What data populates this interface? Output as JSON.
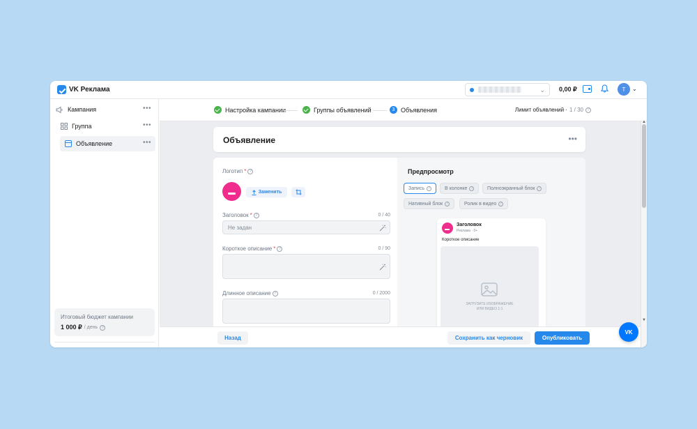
{
  "app": {
    "title": "VK Реклама"
  },
  "topbar": {
    "balance": "0,00 ₽",
    "avatar_initial": "Т",
    "account_chevron": "⌄",
    "avatar_chevron": "⌄"
  },
  "sidebar": {
    "items": [
      {
        "label": "Кампания",
        "icon": "megaphone-icon"
      },
      {
        "label": "Группа",
        "icon": "grid-icon"
      },
      {
        "label": "Объявление",
        "icon": "ad-card-icon"
      }
    ],
    "dots": "•••",
    "budget": {
      "label": "Итоговый бюджет кампании",
      "value": "1 000 ₽",
      "unit": "/ день"
    }
  },
  "stepper": {
    "steps": [
      {
        "label": "Настройка кампании",
        "state": "done"
      },
      {
        "label": "Группы объявлений",
        "state": "done"
      },
      {
        "label": "Объявления",
        "state": "current",
        "number": "3"
      }
    ],
    "limit_label": "Лимит объявлений ·",
    "limit_count": "1 / 30"
  },
  "header": {
    "title": "Объявление",
    "dots": "•••"
  },
  "form": {
    "logo_label": "Логотип",
    "replace_label": "Заменить",
    "title_label": "Заголовок",
    "title_counter": "0 / 40",
    "title_placeholder": "Не задан",
    "short_label": "Короткое описание",
    "short_counter": "0 / 90",
    "long_label": "Длинное описание",
    "long_counter": "0 / 2000",
    "required_mark": "*",
    "info_glyph": "?"
  },
  "preview": {
    "title": "Предпросмотр",
    "chips": [
      "Запись",
      "В колонке",
      "Полноэкранный блок",
      "Нативный блок",
      "Ролик в видео"
    ],
    "ad": {
      "title": "Заголовок",
      "subtitle": "Реклама · 0+",
      "description": "Короткое описание",
      "image_text_1": "Загрузите изображение",
      "image_text_2": "или видео 1:1"
    }
  },
  "footer": {
    "back": "Назад",
    "draft": "Сохранить как черновик",
    "publish": "Опубликовать"
  },
  "fab": {
    "label": "VK"
  },
  "colors": {
    "accent": "#2688eb",
    "success": "#4bb34b",
    "brand_pink": "#f02d8d",
    "background": "#b8d9f3"
  }
}
